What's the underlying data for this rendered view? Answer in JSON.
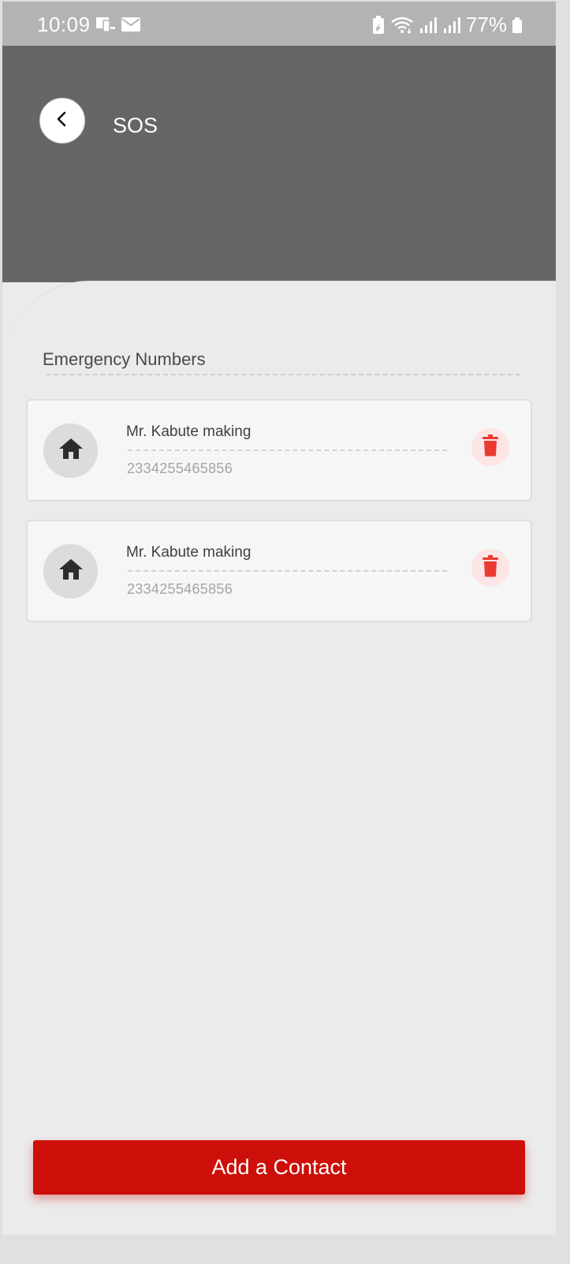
{
  "status_bar": {
    "time": "10:09",
    "battery_percent": "77%",
    "left_icons": [
      "screen-mirror-icon",
      "mail-icon"
    ],
    "right_icons": [
      "battery-saver-icon",
      "wifi-icon",
      "signal-icon",
      "signal-icon",
      "battery-icon"
    ]
  },
  "header": {
    "title": "SOS",
    "back_icon": "chevron-left-icon",
    "background_color": "#666666"
  },
  "section": {
    "title": "Emergency Numbers"
  },
  "contacts": [
    {
      "name": "Mr. Kabute making",
      "number": "2334255465856",
      "icon": "home-icon",
      "action_icon": "trash-icon"
    },
    {
      "name": "Mr. Kabute making",
      "number": "2334255465856",
      "icon": "home-icon",
      "action_icon": "trash-icon"
    }
  ],
  "footer": {
    "add_button_label": "Add a Contact",
    "accent_color": "#cc0f08"
  }
}
